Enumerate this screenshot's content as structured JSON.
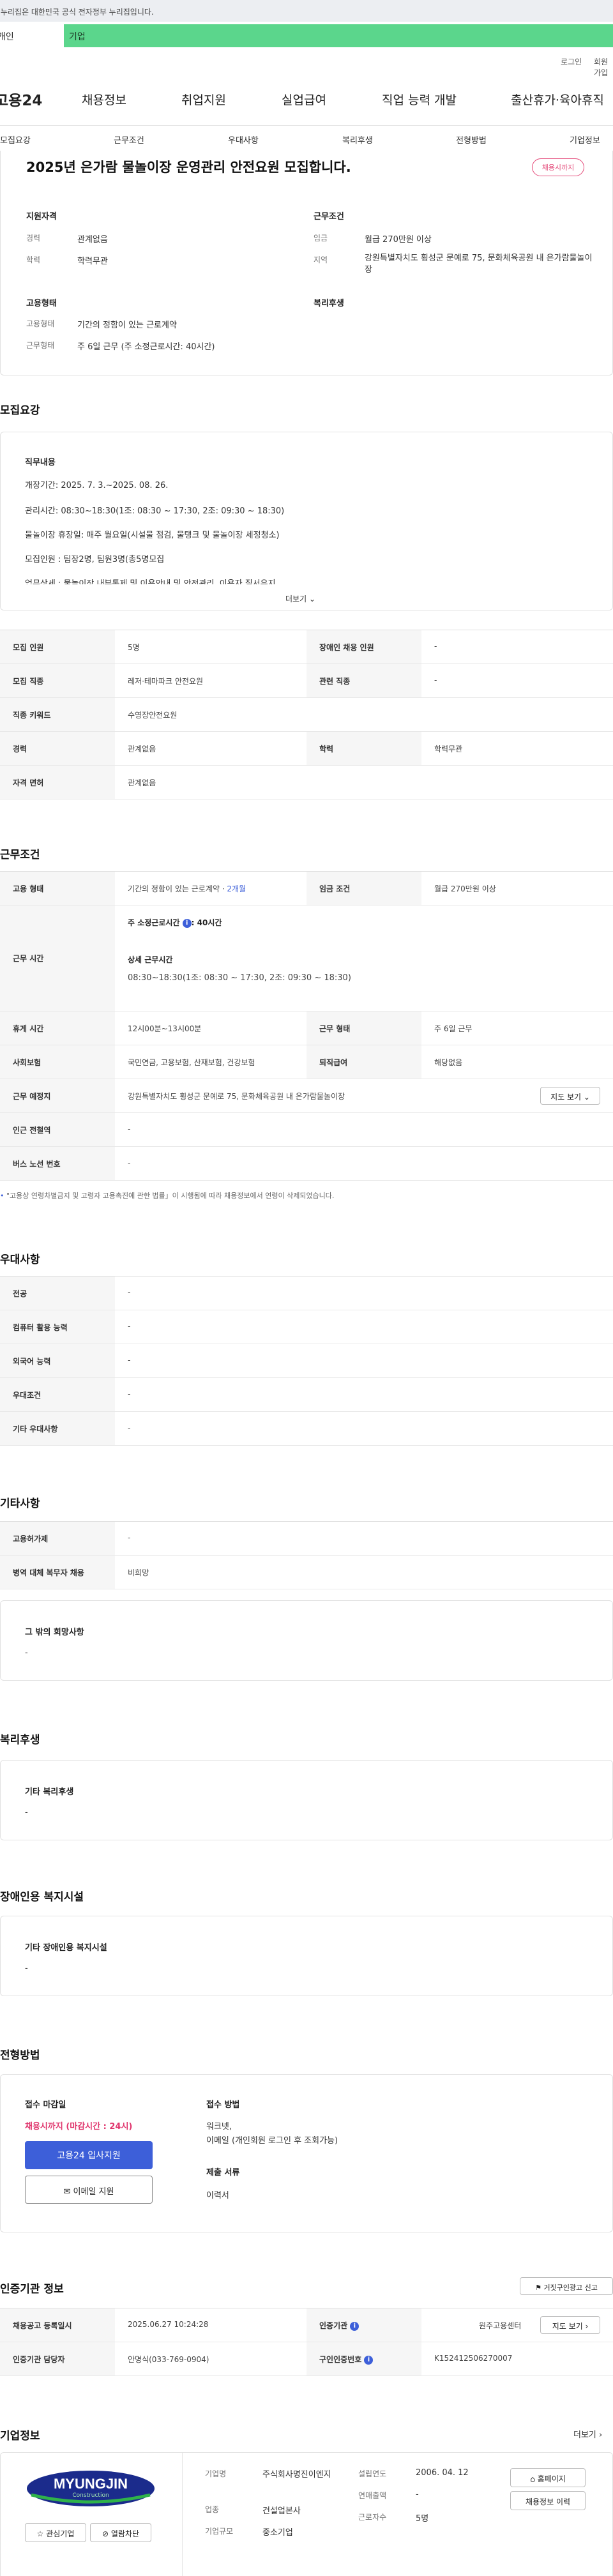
{
  "gov_banner": "이 누리집은 대한민국 공식 전자정부 누리집입니다.",
  "top_tabs": {
    "person": "개인",
    "company": "기업"
  },
  "util": {
    "login": "로그인",
    "signup": "회원가입"
  },
  "gnb": {
    "logo": "고용24",
    "items": [
      "채용정보",
      "취업지원",
      "실업급여",
      "직업 능력 개발",
      "출산휴가·육아휴직"
    ]
  },
  "subnav": [
    "모집요강",
    "근무조건",
    "우대사항",
    "복리후생",
    "전형방법",
    "기업정보"
  ],
  "summary": {
    "title": "2025년 은가람 물놀이장 운영관리 안전요원 모집합니다.",
    "badge": "채용시까지",
    "qual_heading": "지원자격",
    "qual": [
      {
        "k": "경력",
        "v": "관계없음"
      },
      {
        "k": "학력",
        "v": "학력무관"
      }
    ],
    "cond_heading": "근무조건",
    "cond": [
      {
        "k": "임금",
        "v": "월급 270만원 이상"
      },
      {
        "k": "지역",
        "v": "강원특별자치도 횡성군 문예로 75, 문화체육공원 내 은가람물놀이장"
      }
    ],
    "emp_heading": "고용형태",
    "emp": [
      {
        "k": "고용형태",
        "v": "기간의 정함이 있는 근로계약"
      },
      {
        "k": "근무형태",
        "v": "주 6일 근무 (주 소정근로시간: 40시간)"
      }
    ],
    "welfare_heading": "복리후생"
  },
  "recruit": {
    "title": "모집요강",
    "duty_heading": "직무내용",
    "lines": [
      "개장기간: 2025. 7. 3.~2025. 08. 26.",
      "관리시간: 08:30~18:30(1조: 08:30 ~ 17:30, 2조: 09:30 ~ 18:30)",
      "물놀이장 휴장일: 매주 월요일(시설물 점검, 물탱크 및 물놀이장 세정청소)",
      "모집인원 : 팀장2명, 팀원3명(총5명모집",
      "업무상세 : 물놀이장 내부통제 및 이용안내 및 안전관리, 이용자 질서유지"
    ],
    "more": "더보기",
    "rows": [
      [
        {
          "k": "모집 인원",
          "v": "5명"
        },
        {
          "k": "장애인 채용 인원",
          "v": "-"
        }
      ],
      [
        {
          "k": "모집 직종",
          "v": "레저·테마파크 안전요원"
        },
        {
          "k": "관련 직종",
          "v": "-"
        }
      ],
      [
        {
          "k": "직종 키워드",
          "v": "수영장안전요원"
        }
      ],
      [
        {
          "k": "경력",
          "v": "관계없음"
        },
        {
          "k": "학력",
          "v": "학력무관"
        }
      ],
      [
        {
          "k": "자격 면허",
          "v": "관계없음"
        }
      ]
    ]
  },
  "work": {
    "title": "근무조건",
    "emp_k": "고용 형태",
    "emp_v": "기간의 정함이 있는 근로계약 · ",
    "emp_months": "2개월",
    "wage_k": "임금 조건",
    "wage_v": "월급 270만원 이상",
    "hours_k": "근무 시간",
    "hours_sub1": "주 소정근로시간",
    "hours_sub1_v": ": 40시간",
    "hours_sub2": "상세 근무시간",
    "hours_detail": "08:30~18:30(1조: 08:30 ~ 17:30, 2조: 09:30 ~ 18:30)",
    "break_k": "휴게 시간",
    "break_v": "12시00분~13시00분",
    "form_k": "근무 형태",
    "form_v": "주 6일 근무",
    "ins_k": "사회보험",
    "ins_v": "국민연금, 고용보험, 산재보험, 건강보험",
    "sev_k": "퇴직급여",
    "sev_v": "해당없음",
    "place_k": "근무 예정지",
    "place_v": "강원특별자치도 횡성군 문예로 75, 문화체육공원 내 은가람물놀이장",
    "map_btn": "지도 보기",
    "subway_k": "인근 전철역",
    "subway_v": "-",
    "bus_k": "버스 노선 번호",
    "bus_v": "-",
    "note": "\"고용상 연령차별금지 및 고령자 고용촉진에 관한 법률」이 시행됨에 따라 채용정보에서 연령이 삭제되었습니다."
  },
  "pref": {
    "title": "우대사항",
    "rows": [
      {
        "k": "전공",
        "v": "-"
      },
      {
        "k": "컴퓨터 활용 능력",
        "v": "-"
      },
      {
        "k": "외국어 능력",
        "v": "-"
      },
      {
        "k": "우대조건",
        "v": "-"
      },
      {
        "k": "기타 우대사항",
        "v": "-"
      }
    ]
  },
  "etc": {
    "title": "기타사항",
    "rows": [
      {
        "k": "고용허가제",
        "v": "-"
      },
      {
        "k": "병역 대체 복무자 채용",
        "v": "비희망"
      }
    ],
    "other_heading": "그 밖의 희망사항",
    "other_v": "-"
  },
  "welfare": {
    "title": "복리후생",
    "heading": "기타 복리후생",
    "v": "-"
  },
  "disabled": {
    "title": "장애인용 복지시설",
    "heading": "기타 장애인용 복지시설",
    "v": "-"
  },
  "apply": {
    "title": "전형방법",
    "deadline_heading": "접수 마감일",
    "deadline_v": "채용시까지 (마감시간 : 24시)",
    "apply_btn": "고용24 입사지원",
    "email_btn": "이메일 지원",
    "method_heading": "접수 방법",
    "method_v1": "워크넷,",
    "method_v2": "이메일 (개인회원 로그인 후 조회가능)",
    "docs_heading": "제출 서류",
    "docs_v": "이력서"
  },
  "cert": {
    "title": "인증기관 정보",
    "report_btn": "거짓구인광고 신고",
    "r1": [
      {
        "k": "채용공고 등록일시",
        "v": "2025.06.27 10:24:28"
      },
      {
        "k": "인증기관",
        "v": "원주고용센터"
      }
    ],
    "r2": [
      {
        "k": "인증기관 담당자",
        "v": "안명식(033-769-0904)"
      },
      {
        "k": "구인인증번호",
        "v": "K152412506270007"
      }
    ],
    "map_btn": "지도 보기"
  },
  "company": {
    "title": "기업정보",
    "more": "더보기",
    "logo_text": "MYUNGJIN",
    "logo_sub": "Construction",
    "fav_btn": "관심기업",
    "block_btn": "열람차단",
    "rows": [
      {
        "k": "기업명",
        "v": "주식회사명진이엔지"
      },
      {
        "k": "업종",
        "v": "건설업본사"
      },
      {
        "k": "기업규모",
        "v": "중소기업"
      }
    ],
    "rows2": [
      {
        "k": "설립연도",
        "v": "2006. 04. 12"
      },
      {
        "k": "연매출액",
        "v": "-"
      },
      {
        "k": "근로자수",
        "v": "5명"
      }
    ],
    "home_btn": "홈페이지",
    "jobs_btn": "채용정보 이력"
  },
  "colors": {
    "accent": "#3d5fd9",
    "deadline": "#e0356d",
    "company_tab": "#5bd68c"
  }
}
